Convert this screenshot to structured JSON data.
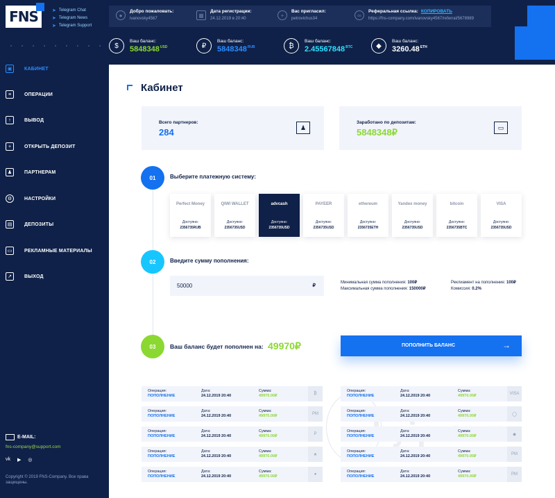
{
  "brand": {
    "logo": "FNS"
  },
  "telegram": [
    "Telegram Chat",
    "Telegram News",
    "Telegram Support"
  ],
  "header": {
    "info": [
      {
        "label": "Добро пожаловать:",
        "value": "ivanovsky4567",
        "icon": "user-icon"
      },
      {
        "label": "Дата регистрации:",
        "value": "24.12.2019 в 20:40",
        "icon": "calendar-icon"
      },
      {
        "label": "Вас пригласил:",
        "value": "petrovichus34",
        "icon": "invited-by-icon"
      },
      {
        "label": "Реферальная ссылка:",
        "copy": "КОПИРОВАТЬ",
        "value": "https://fns-company.com/ivanovsky4567/referral/5678989",
        "icon": "link-icon"
      }
    ],
    "balances": [
      {
        "label": "Ваш баланс:",
        "value": "5848348",
        "unit": "USD",
        "icon": "dollar-icon",
        "color": "#8bd832"
      },
      {
        "label": "Ваш баланс:",
        "value": "5848348",
        "unit": "RUB",
        "icon": "ruble-icon",
        "color": "#2a8cff"
      },
      {
        "label": "Ваш баланс:",
        "value": "2.45567848",
        "unit": "BTC",
        "icon": "bitcoin-icon",
        "color": "#2fe0ff"
      },
      {
        "label": "Ваш баланс:",
        "value": "3260.48",
        "unit": "ETH",
        "icon": "ethereum-icon",
        "color": "#ffffff"
      }
    ]
  },
  "sidebar": {
    "items": [
      {
        "label": "КАБИНЕТ",
        "icon": "cabinet-icon",
        "active": true
      },
      {
        "label": "ОПЕРАЦИИ",
        "icon": "operations-icon"
      },
      {
        "label": "ВЫВОД",
        "icon": "withdraw-icon"
      },
      {
        "label": "ОТКРЫТЬ ДЕПОЗИТ",
        "icon": "open-deposit-icon"
      },
      {
        "label": "ПАРТНЕРАМ",
        "icon": "partners-icon"
      },
      {
        "label": "НАСТРОЙКИ",
        "icon": "settings-icon"
      },
      {
        "label": "ДЕПОЗИТЫ",
        "icon": "deposits-icon"
      },
      {
        "label": "РЕКЛАМНЫЕ МАТЕРИАЛЫ",
        "icon": "promo-materials-icon"
      },
      {
        "label": "ВЫХОД",
        "icon": "logout-icon"
      }
    ],
    "email_label": "E-MAIL:",
    "email": "fns-company@support.com",
    "socials": [
      "vk-icon",
      "youtube-icon",
      "instagram-icon"
    ],
    "copyright": "Copyright © 2019 FNS-Company. Все права защищены."
  },
  "main": {
    "title": "Кабинет",
    "stats": [
      {
        "label": "Всего партнеров:",
        "value": "284",
        "color": "#1471f0",
        "icon": "partners-group-icon"
      },
      {
        "label": "Заработано по депозитам:",
        "value": "5848348₽",
        "color": "#8bd832",
        "icon": "wallet-icon"
      }
    ],
    "steps": [
      {
        "num": "01",
        "label": "Выберите платежную систему:",
        "color": "#1471f0"
      },
      {
        "num": "02",
        "label": "Введите сумму пополнения:",
        "color": "#17c6ff"
      },
      {
        "num": "03",
        "label": "Ваш баланс будет пополнен на:",
        "color": "#8bd832"
      }
    ],
    "payments": [
      {
        "name": "Perfect Money",
        "available": "Доступно:",
        "amount": "2356735RUB"
      },
      {
        "name": "QIWI WALLET",
        "available": "Доступно:",
        "amount": "2356735USD"
      },
      {
        "name": "advcash",
        "available": "Доступно:",
        "amount": "2356735USD",
        "selected": true
      },
      {
        "name": "PAYEER",
        "available": "Доступно:",
        "amount": "2356735USD"
      },
      {
        "name": "ethereum",
        "available": "Доступно:",
        "amount": "2356735ETH"
      },
      {
        "name": "Yandex money",
        "available": "Доступно:",
        "amount": "2356735USD"
      },
      {
        "name": "bitcoin",
        "available": "Доступно:",
        "amount": "2356735BTC"
      },
      {
        "name": "VISA",
        "available": "Доступно:",
        "amount": "2356735USD"
      }
    ],
    "amount_value": "50000",
    "amount_currency": "₽",
    "limits": {
      "min_label": "Минимальная сумма пополнения:",
      "min_value": "100₽",
      "max_label": "Максимальная сумма пополнения:",
      "max_value": "150000₽",
      "fee_label": "Реклиамент на пополнение:",
      "fee_value": "100₽",
      "commission_label": "Комиссия:",
      "commission_value": "0.2%"
    },
    "result_value": "49970₽",
    "topup_button": "ПОПОЛНИТЬ БАЛАНС",
    "operations": [
      {
        "op_label": "Операция:",
        "op": "ПОПОЛНЕНИЕ",
        "date_label": "Дата:",
        "date": "24.12.2019 20:40",
        "sum_label": "Сумма:",
        "sum": "49970.00₽",
        "icon": "bitcoin-icon"
      },
      {
        "op_label": "Операция:",
        "op": "ПОПОЛНЕНИЕ",
        "date_label": "Дата:",
        "date": "24.12.2019 20:40",
        "sum_label": "Сумма:",
        "sum": "49970.00₽",
        "icon": "visa-icon"
      },
      {
        "op_label": "Операция:",
        "op": "ПОПОЛНЕНИЕ",
        "date_label": "Дата:",
        "date": "24.12.2019 20:40",
        "sum_label": "Сумма:",
        "sum": "49970.00₽",
        "icon": "perfect-money-icon"
      },
      {
        "op_label": "Операция:",
        "op": "ПОПОЛНЕНИЕ",
        "date_label": "Дата:",
        "date": "24.12.2019 20:40",
        "sum_label": "Сумма:",
        "sum": "49970.00₽",
        "icon": "qiwi-icon"
      },
      {
        "op_label": "Операция:",
        "op": "ПОПОЛНЕНИЕ",
        "date_label": "Дата:",
        "date": "24.12.2019 20:40",
        "sum_label": "Сумма:",
        "sum": "49970.00₽",
        "icon": "payeer-icon"
      },
      {
        "op_label": "Операция:",
        "op": "ПОПОЛНЕНИЕ",
        "date_label": "Дата:",
        "date": "24.12.2019 20:40",
        "sum_label": "Сумма:",
        "sum": "49970.00₽",
        "icon": "ethereum-icon"
      },
      {
        "op_label": "Операция:",
        "op": "ПОПОЛНЕНИЕ",
        "date_label": "Дата:",
        "date": "24.12.2019 20:40",
        "sum_label": "Сумма:",
        "sum": "49970.00₽",
        "icon": "advcash-icon"
      },
      {
        "op_label": "Операция:",
        "op": "ПОПОЛНЕНИЕ",
        "date_label": "Дата:",
        "date": "24.12.2019 20:40",
        "sum_label": "Сумма:",
        "sum": "49970.00₽",
        "icon": "perfect-money-icon"
      },
      {
        "op_label": "Операция:",
        "op": "ПОПОЛНЕНИЕ",
        "date_label": "Дата:",
        "date": "24.12.2019 20:40",
        "sum_label": "Сумма:",
        "sum": "49970.00₽",
        "icon": "apple-icon"
      },
      {
        "op_label": "Операция:",
        "op": "ПОПОЛНЕНИЕ",
        "date_label": "Дата:",
        "date": "24.12.2019 20:40",
        "sum_label": "Сумма:",
        "sum": "49970.00₽",
        "icon": "perfect-money-icon"
      }
    ],
    "watermark": "hyip.com"
  }
}
